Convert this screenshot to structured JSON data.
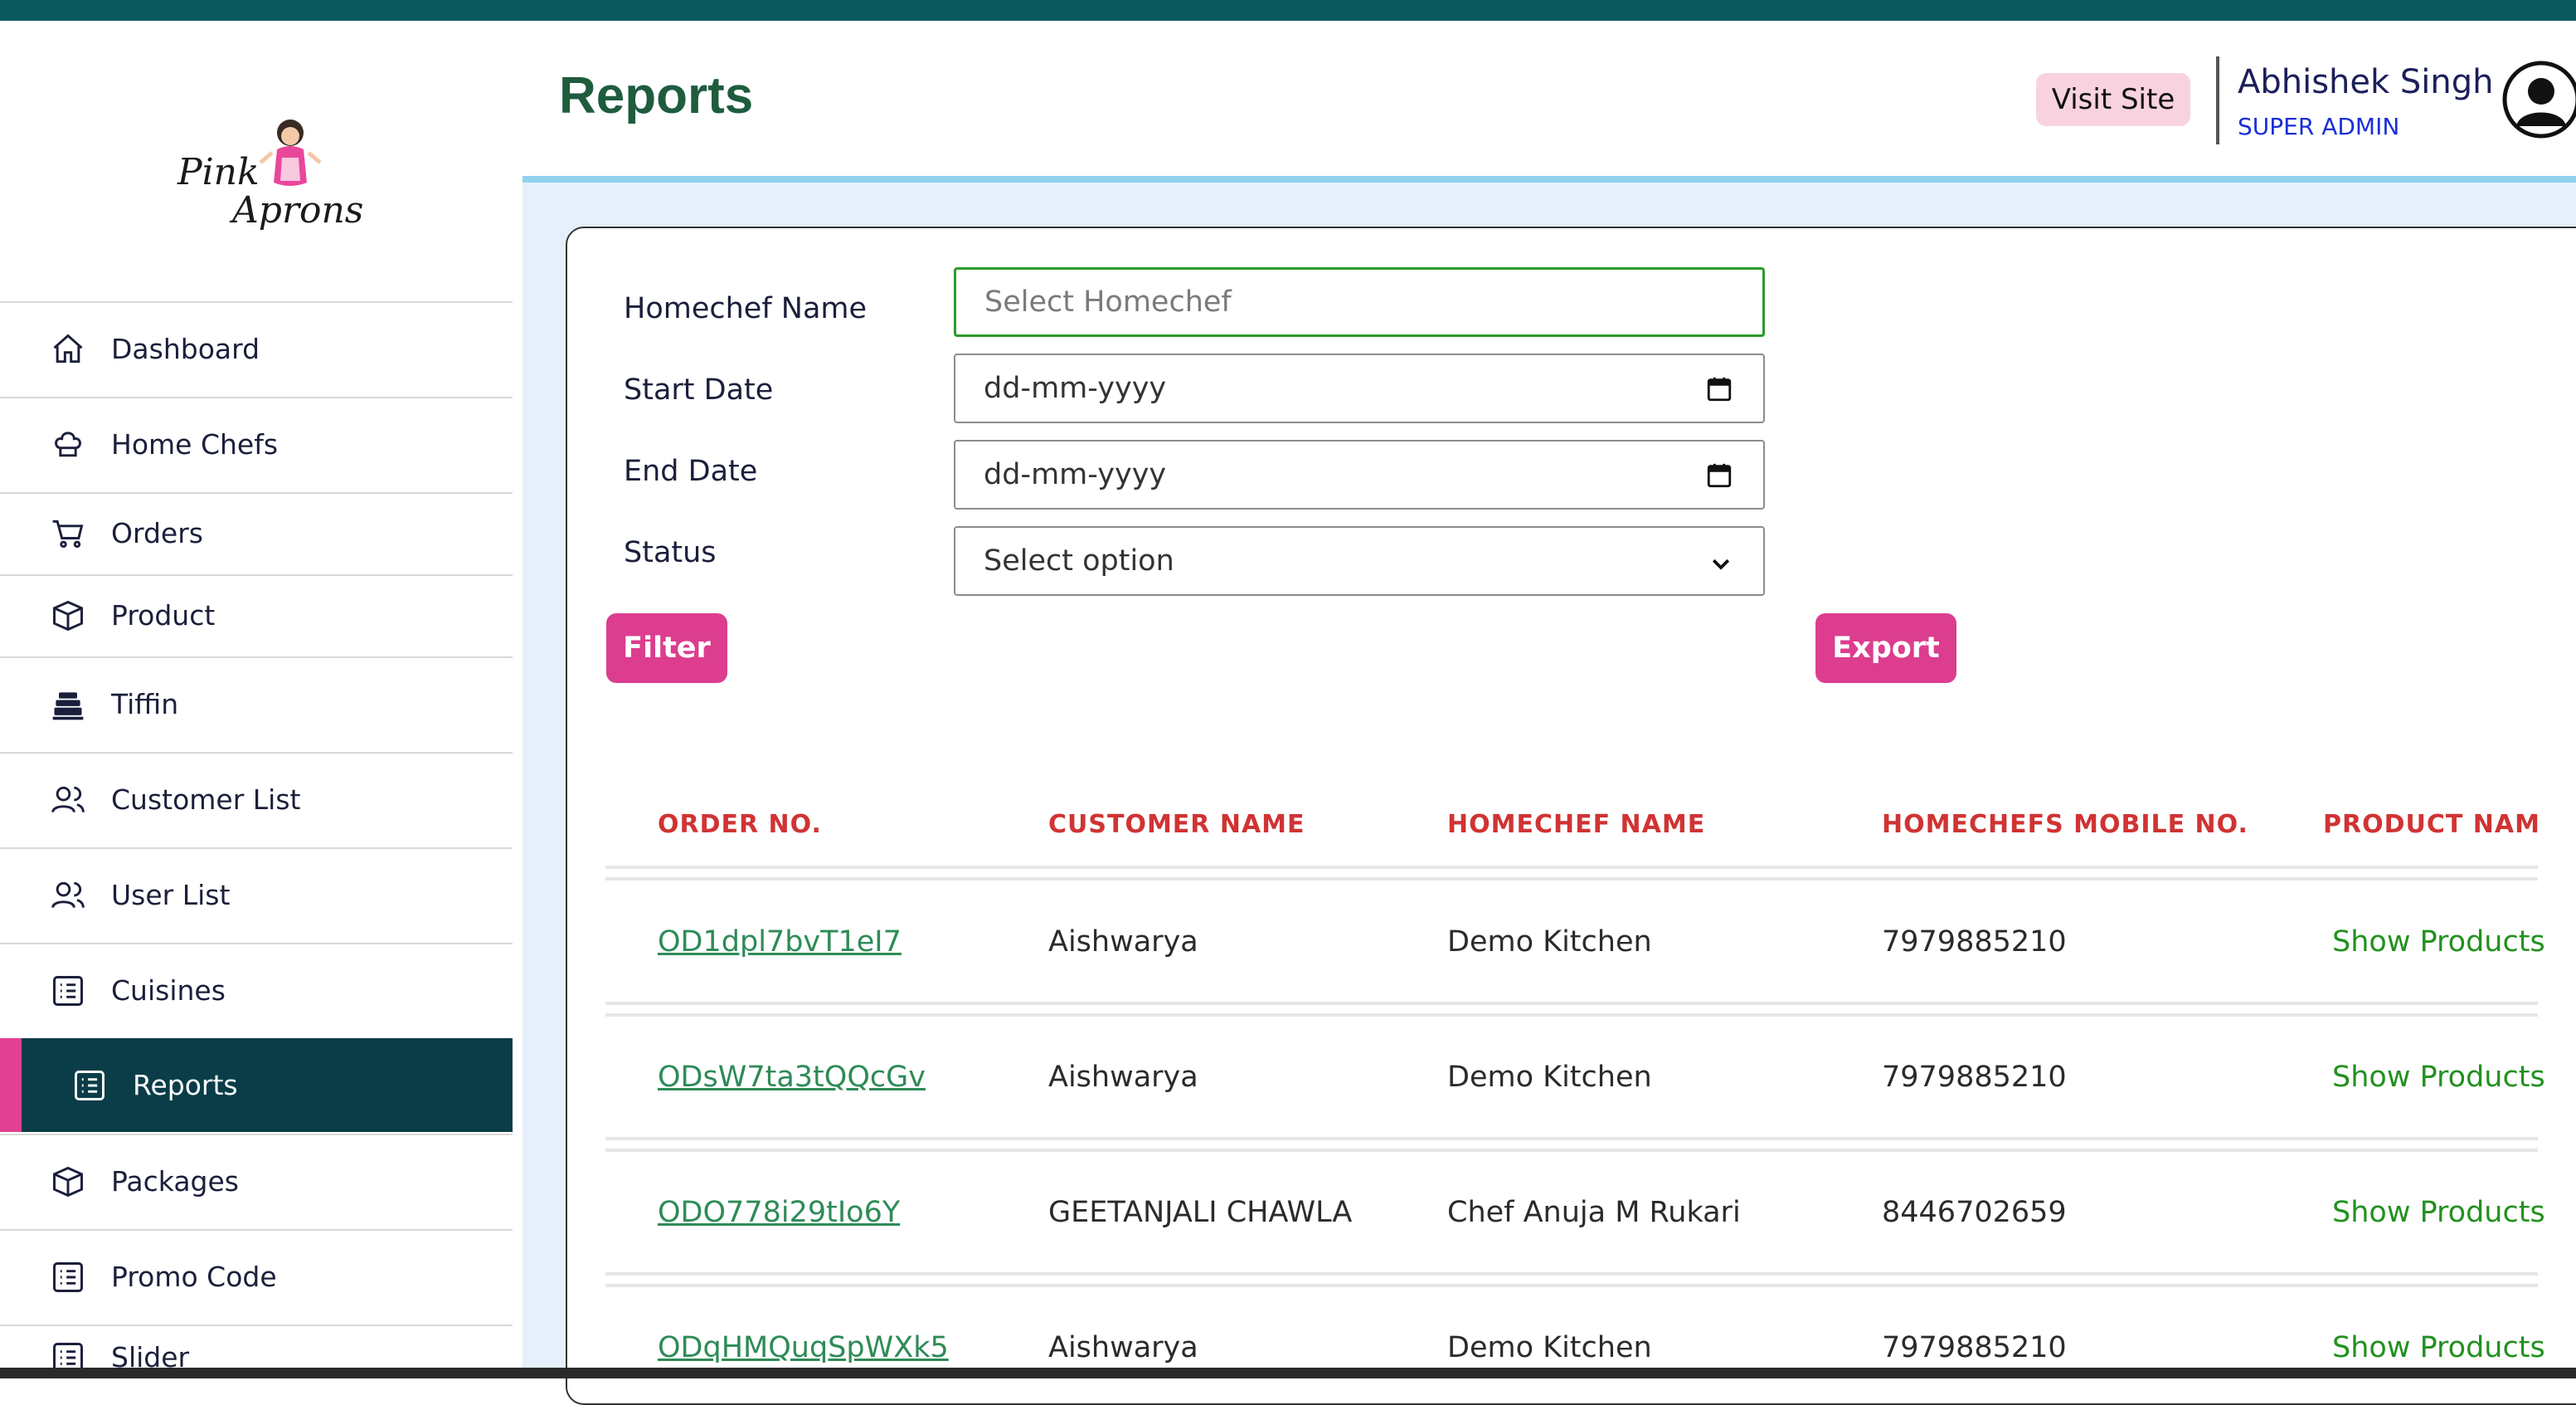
{
  "app": {
    "logo_text_1": "Pink",
    "logo_text_2": "Aprons"
  },
  "sidebar": {
    "items": [
      {
        "label": "Dashboard",
        "icon": "home-icon"
      },
      {
        "label": "Home Chefs",
        "icon": "chef-hat-icon"
      },
      {
        "label": "Orders",
        "icon": "cart-icon"
      },
      {
        "label": "Product",
        "icon": "box-icon"
      },
      {
        "label": "Tiffin",
        "icon": "tiffin-icon"
      },
      {
        "label": "Customer List",
        "icon": "users-icon"
      },
      {
        "label": "User List",
        "icon": "users-icon"
      },
      {
        "label": "Cuisines",
        "icon": "list-icon"
      },
      {
        "label": "Reports",
        "icon": "list-icon",
        "active": true
      },
      {
        "label": "Packages",
        "icon": "box-icon"
      },
      {
        "label": "Promo Code",
        "icon": "list-icon"
      },
      {
        "label": "Slider",
        "icon": "list-icon"
      }
    ]
  },
  "header": {
    "title": "Reports",
    "visit_site": "Visit Site",
    "user_name": "Abhishek Singh",
    "user_role": "SUPER ADMIN"
  },
  "filters": {
    "homechef_label": "Homechef Name",
    "homechef_placeholder": "Select Homechef",
    "start_label": "Start Date",
    "start_value": "dd-mm-yyyy",
    "end_label": "End Date",
    "end_value": "dd-mm-yyyy",
    "status_label": "Status",
    "status_value": "Select option",
    "filter_button": "Filter",
    "export_button": "Export"
  },
  "table": {
    "headers": [
      "ORDER NO.",
      "CUSTOMER NAME",
      "HOMECHEF NAME",
      "HOMECHEFS MOBILE NO.",
      "PRODUCT NAMI"
    ],
    "rows": [
      {
        "order": "OD1dpl7bvT1eI7",
        "customer": "Aishwarya",
        "chef": "Demo Kitchen",
        "mobile": "7979885210",
        "products": "Show Products"
      },
      {
        "order": "ODsW7ta3tQQcGv",
        "customer": "Aishwarya",
        "chef": "Demo Kitchen",
        "mobile": "7979885210",
        "products": "Show Products"
      },
      {
        "order": "ODO778i29tIo6Y",
        "customer": "GEETANJALI CHAWLA",
        "chef": "Chef Anuja M Rukari",
        "mobile": "8446702659",
        "products": "Show Products"
      },
      {
        "order": "ODqHMQuqSpWXk5",
        "customer": "Aishwarya",
        "chef": "Demo Kitchen",
        "mobile": "7979885210",
        "products": "Show Products"
      }
    ]
  },
  "colors": {
    "topbar": "#0b5a60",
    "active_nav": "#0a3d47",
    "accent_pink": "#dc3d8f",
    "title_green": "#1f5c3e",
    "header_red": "#d03333"
  }
}
